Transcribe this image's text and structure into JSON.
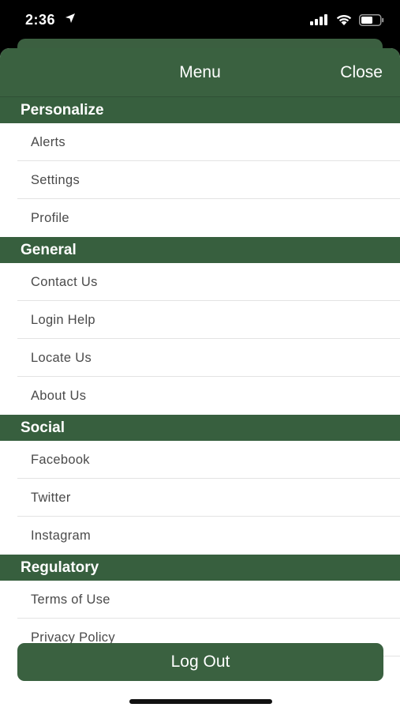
{
  "status_bar": {
    "time": "2:36"
  },
  "header": {
    "title": "Menu",
    "close_label": "Close"
  },
  "sections": [
    {
      "title": "Personalize",
      "items": [
        "Alerts",
        "Settings",
        "Profile"
      ]
    },
    {
      "title": "General",
      "items": [
        "Contact Us",
        "Login Help",
        "Locate Us",
        "About Us"
      ]
    },
    {
      "title": "Social",
      "items": [
        "Facebook",
        "Twitter",
        "Instagram"
      ]
    },
    {
      "title": "Regulatory",
      "items": [
        "Terms of Use",
        "Privacy Policy"
      ]
    }
  ],
  "footer": {
    "logout_label": "Log Out"
  },
  "colors": {
    "brand_green": "#3a6140",
    "section_green": "#375f3e"
  }
}
